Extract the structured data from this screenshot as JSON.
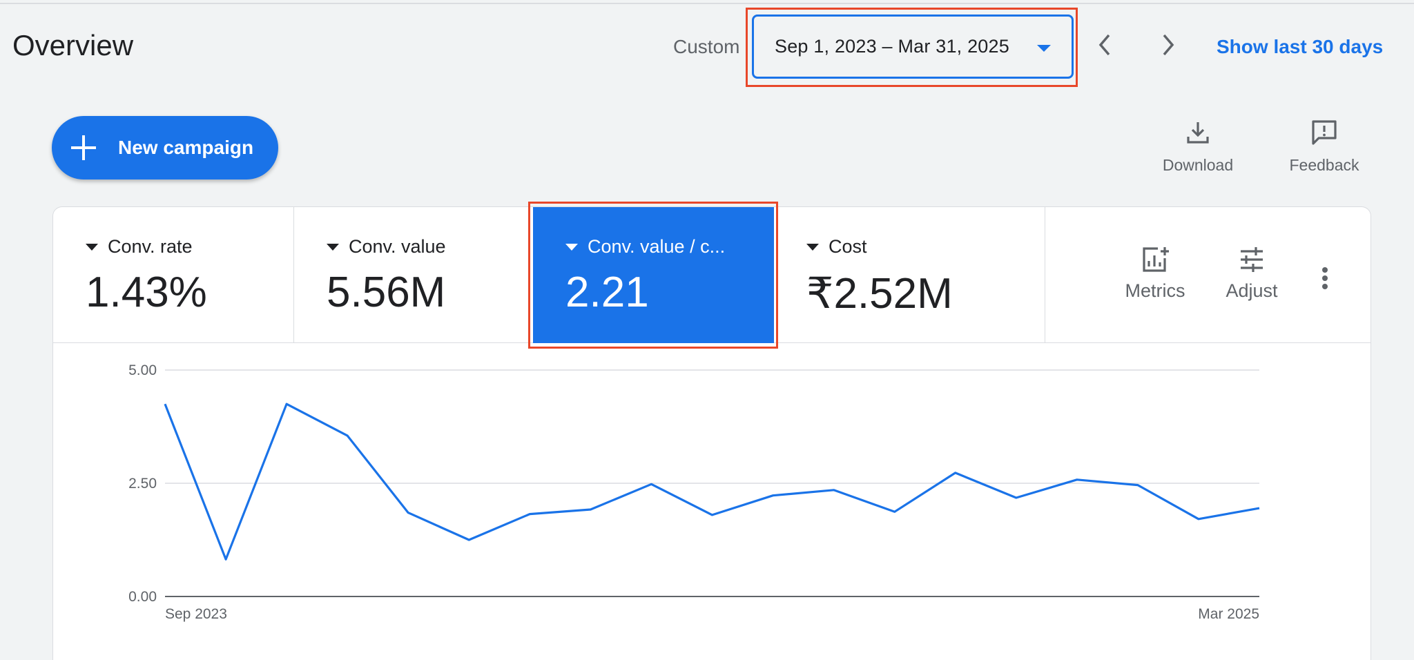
{
  "header": {
    "title": "Overview",
    "custom_label": "Custom",
    "date_range": "Sep 1, 2023 – Mar 31, 2025",
    "show_last_label": "Show last 30 days"
  },
  "toolbar": {
    "new_campaign_label": "New campaign",
    "download_label": "Download",
    "feedback_label": "Feedback"
  },
  "metrics": [
    {
      "name": "Conv. rate",
      "value": "1.43%"
    },
    {
      "name": "Conv. value",
      "value": "5.56M"
    },
    {
      "name": "Conv. value / c...",
      "value": "2.21",
      "selected": true
    },
    {
      "name": "Cost",
      "value": "₹2.52M"
    }
  ],
  "card_tools": {
    "metrics_label": "Metrics",
    "adjust_label": "Adjust"
  },
  "colors": {
    "accent": "#1a73e8",
    "highlight": "#e8472a"
  },
  "icons": [
    "plus-icon",
    "chevron-left-icon",
    "chevron-right-icon",
    "dropdown-arrow-icon",
    "download-icon",
    "feedback-icon",
    "metrics-icon",
    "adjust-icon",
    "more-vert-icon"
  ],
  "chart_data": {
    "type": "line",
    "y_ticks": [
      "5.00",
      "2.50",
      "0.00"
    ],
    "ylim": [
      0,
      5
    ],
    "x_labels": [
      "Sep 2023",
      "Mar 2025"
    ],
    "grid": true,
    "series": [
      {
        "values": [
          4.25,
          0.82,
          4.25,
          3.55,
          1.85,
          1.25,
          1.82,
          1.92,
          2.48,
          1.8,
          2.23,
          2.35,
          1.87,
          2.73,
          2.18,
          2.58,
          2.46,
          1.71,
          1.95
        ]
      }
    ]
  }
}
